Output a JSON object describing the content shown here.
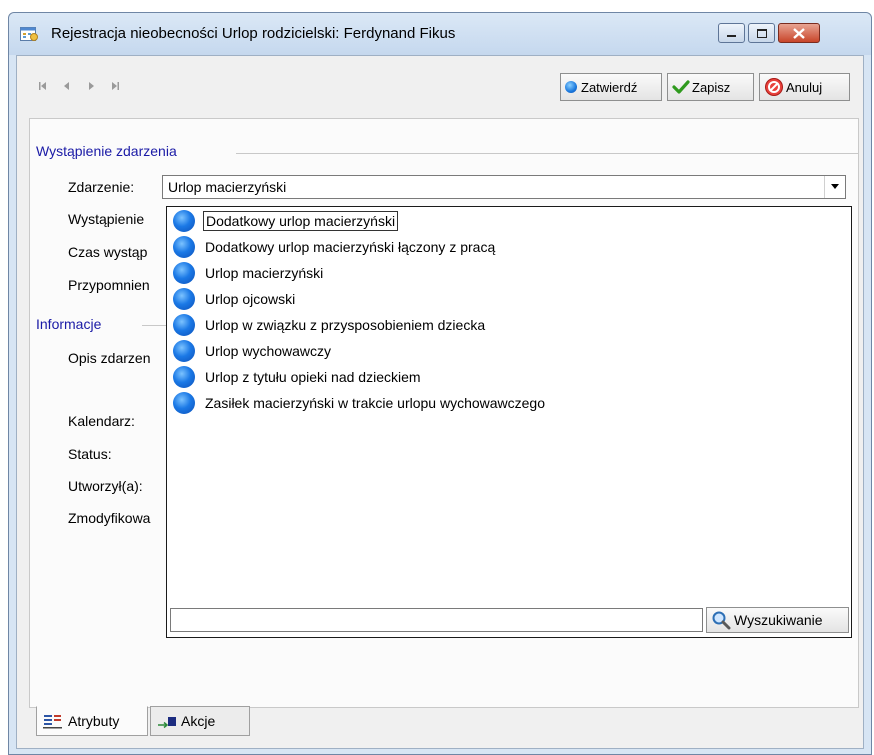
{
  "window": {
    "title": "Rejestracja nieobecności Urlop rodzicielski:  Ferdynand Fikus",
    "icons": {
      "app": "calendar-icon",
      "minimize": "minimize-icon",
      "maximize": "maximize-icon",
      "close": "close-icon"
    }
  },
  "toolbar": {
    "nav_icons": [
      "first-record-icon",
      "previous-record-icon",
      "next-record-icon",
      "last-record-icon"
    ],
    "confirm_label": "Zatwierdź",
    "save_label": "Zapisz",
    "cancel_label": "Anuluj"
  },
  "section_occurrence": {
    "title": "Wystąpienie zdarzenia",
    "event_label": "Zdarzenie:",
    "event_value": "Urlop macierzyński",
    "occurrence_label": "Wystąpienie",
    "time_label": "Czas wystąp",
    "reminder_label": "Przypomnien"
  },
  "section_info": {
    "title": "Informacje",
    "description_label": "Opis zdarzen",
    "calendar_label": "Kalendarz:",
    "status_label": "Status:",
    "created_label": "Utworzył(a):",
    "modified_label": "Zmodyfikowa"
  },
  "dropdown": {
    "options": [
      "Dodatkowy urlop macierzyński",
      "Dodatkowy urlop macierzyński łączony z pracą",
      "Urlop macierzyński",
      "Urlop ojcowski",
      "Urlop w związku z przysposobieniem dziecka",
      "Urlop wychowawczy",
      "Urlop z tytułu opieki nad dzieckiem",
      "Zasiłek macierzyński w trakcie urlopu wychowawczego"
    ],
    "selected_index": 0,
    "search_value": "",
    "search_button_label": "Wyszukiwanie"
  },
  "tabs": {
    "attributes_label": "Atrybuty",
    "actions_label": "Akcje"
  },
  "colors": {
    "section_title": "#1a1aa6",
    "option_icon": "#1b79e6",
    "window_frame": "#d7e5f4"
  }
}
